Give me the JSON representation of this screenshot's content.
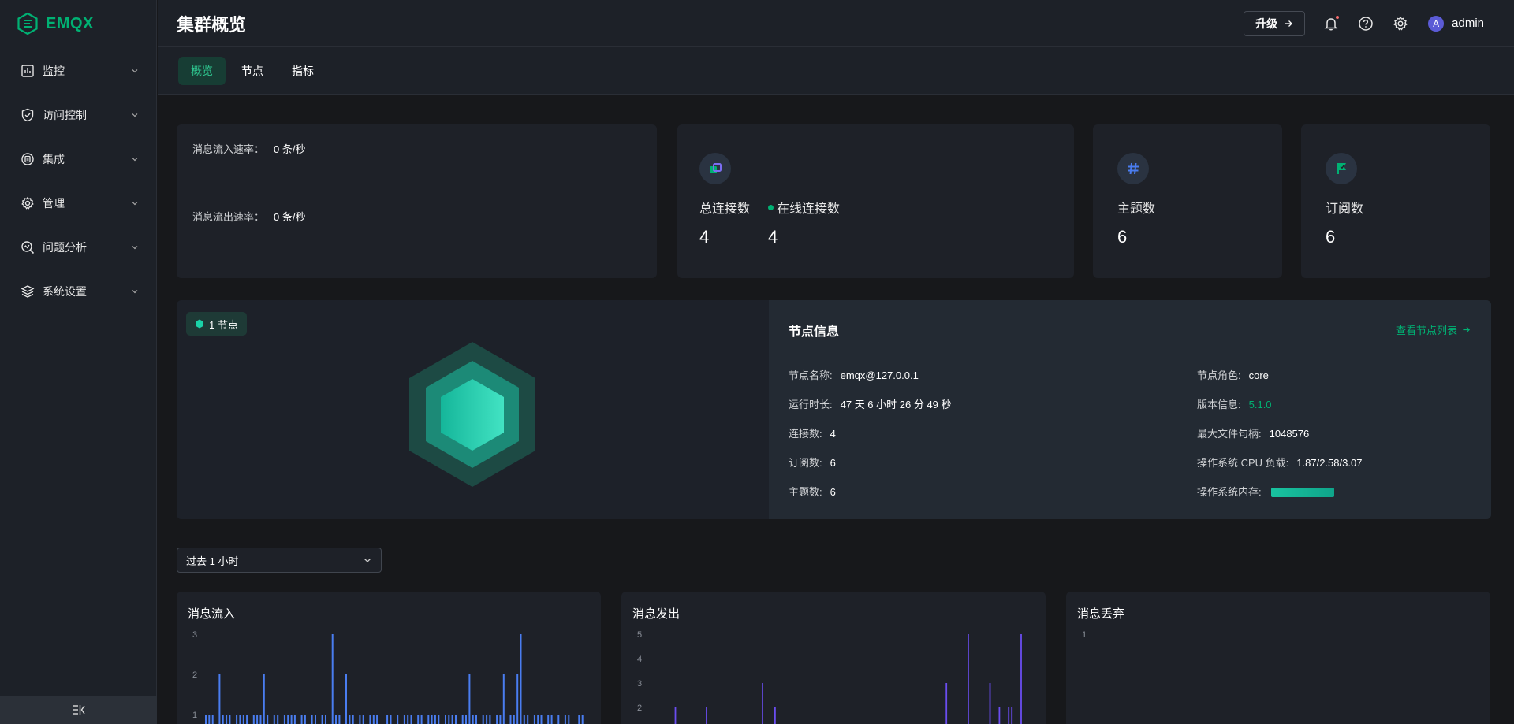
{
  "app": {
    "logo_text": "EMQX",
    "brand_color": "#00b173"
  },
  "sidebar": {
    "items": [
      {
        "label": "监控",
        "icon": "monitor-icon"
      },
      {
        "label": "访问控制",
        "icon": "shield-icon"
      },
      {
        "label": "集成",
        "icon": "integration-icon"
      },
      {
        "label": "管理",
        "icon": "gear-icon"
      },
      {
        "label": "问题分析",
        "icon": "analysis-icon"
      },
      {
        "label": "系统设置",
        "icon": "layers-icon"
      }
    ],
    "collapse_icon": "collapse-sidebar-icon"
  },
  "header": {
    "title": "集群概览",
    "upgrade_label": "升级",
    "username": "admin",
    "avatar_letter": "A"
  },
  "tabs": [
    {
      "label": "概览",
      "active": true
    },
    {
      "label": "节点",
      "active": false
    },
    {
      "label": "指标",
      "active": false
    }
  ],
  "rates": {
    "inflow_label": "消息流入速率：",
    "inflow_value": "0 条/秒",
    "outflow_label": "消息流出速率：",
    "outflow_value": "0 条/秒"
  },
  "stats": {
    "total_connections_label": "总连接数",
    "total_connections_value": "4",
    "online_connections_label": "在线连接数",
    "online_connections_value": "4",
    "topics_label": "主题数",
    "topics_value": "6",
    "subscriptions_label": "订阅数",
    "subscriptions_value": "6"
  },
  "nodes": {
    "badge_label": "1 节点",
    "info_title": "节点信息",
    "view_list_label": "查看节点列表",
    "left": [
      {
        "key": "节点名称:",
        "value": "emqx@127.0.0.1"
      },
      {
        "key": "运行时长:",
        "value": "47 天 6 小时 26 分 49 秒"
      },
      {
        "key": "连接数:",
        "value": "4"
      },
      {
        "key": "订阅数:",
        "value": "6"
      },
      {
        "key": "主题数:",
        "value": "6"
      }
    ],
    "right": [
      {
        "key": "节点角色:",
        "value": "core"
      },
      {
        "key": "版本信息:",
        "value": "5.1.0"
      },
      {
        "key": "最大文件句柄:",
        "value": "1048576"
      },
      {
        "key": "操作系统 CPU 负载:",
        "value": "1.87/2.58/3.07"
      },
      {
        "key": "操作系统内存:",
        "value": ""
      }
    ]
  },
  "time_range": {
    "selected": "过去 1 小时"
  },
  "charts": [
    {
      "title": "消息流入",
      "y_ticks": [
        "3",
        "2",
        "1"
      ],
      "color": "#4a7df0"
    },
    {
      "title": "消息发出",
      "y_ticks": [
        "5",
        "4",
        "3",
        "2"
      ],
      "color": "#6a4df0"
    },
    {
      "title": "消息丢弃",
      "y_ticks": [
        "1"
      ],
      "color": "#888888"
    }
  ],
  "chart_data": [
    {
      "type": "bar",
      "title": "消息流入",
      "ylim": [
        0,
        3
      ],
      "values": [
        1,
        1,
        1,
        0,
        2,
        1,
        1,
        1,
        0,
        1,
        1,
        1,
        1,
        0,
        1,
        1,
        1,
        2,
        1,
        0,
        1,
        1,
        0,
        1,
        1,
        1,
        1,
        0,
        1,
        1,
        0,
        1,
        1,
        0,
        1,
        1,
        0,
        3,
        1,
        1,
        0,
        2,
        1,
        1,
        0,
        1,
        1,
        0,
        1,
        1,
        1,
        0,
        0,
        1,
        1,
        0,
        1,
        0,
        1,
        1,
        1,
        0,
        1,
        1,
        0,
        1,
        1,
        1,
        1,
        0,
        1,
        1,
        1,
        1,
        0,
        1,
        1,
        2,
        1,
        1,
        0,
        1,
        1,
        1,
        0,
        1,
        1,
        2,
        0,
        1,
        1,
        2,
        3,
        1,
        1,
        0,
        1,
        1,
        1,
        0,
        1,
        1,
        0,
        1,
        0,
        1,
        1,
        0,
        0,
        1,
        1
      ]
    },
    {
      "type": "bar",
      "title": "消息发出",
      "ylim": [
        0,
        5
      ],
      "values": [
        0,
        0,
        0,
        0,
        0,
        0,
        0,
        0,
        2,
        0,
        0,
        0,
        0,
        0,
        0,
        0,
        0,
        0,
        2,
        0,
        0,
        0,
        0,
        0,
        0,
        0,
        0,
        0,
        0,
        0,
        0,
        0,
        0,
        0,
        0,
        0,
        3,
        0,
        0,
        0,
        2,
        0,
        0,
        0,
        0,
        0,
        0,
        0,
        0,
        0,
        0,
        0,
        0,
        0,
        0,
        0,
        0,
        0,
        0,
        0,
        0,
        0,
        0,
        0,
        0,
        0,
        0,
        0,
        0,
        0,
        0,
        0,
        0,
        0,
        0,
        0,
        0,
        0,
        0,
        0,
        0,
        0,
        0,
        0,
        0,
        0,
        0,
        0,
        0,
        0,
        0,
        0,
        0,
        0,
        0,
        3,
        0,
        0,
        0,
        0,
        0,
        0,
        5,
        0,
        0,
        0,
        0,
        0,
        0,
        3,
        0,
        0,
        2,
        0,
        0,
        2,
        2,
        0,
        0,
        5,
        0,
        0
      ]
    },
    {
      "type": "bar",
      "title": "消息丢弃",
      "ylim": [
        0,
        1
      ],
      "values": []
    }
  ]
}
